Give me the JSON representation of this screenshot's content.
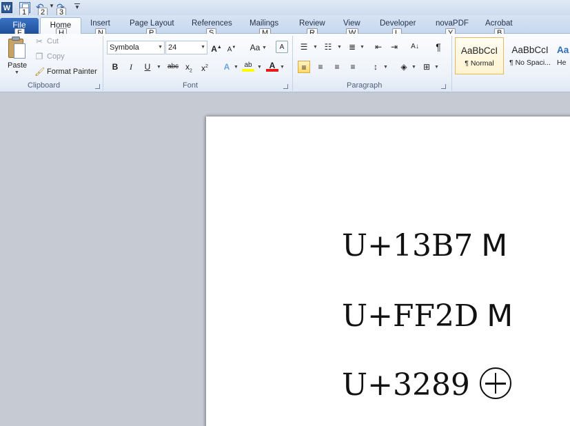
{
  "qat": {
    "app_icon_letter": "W",
    "keytips": [
      "1",
      "2",
      "3"
    ]
  },
  "tabs": [
    {
      "label": "File",
      "keytip": "F"
    },
    {
      "label": "Home",
      "keytip": "H"
    },
    {
      "label": "Insert",
      "keytip": "N"
    },
    {
      "label": "Page Layout",
      "keytip": "P"
    },
    {
      "label": "References",
      "keytip": "S"
    },
    {
      "label": "Mailings",
      "keytip": "M"
    },
    {
      "label": "Review",
      "keytip": "R"
    },
    {
      "label": "View",
      "keytip": "W"
    },
    {
      "label": "Developer",
      "keytip": "L"
    },
    {
      "label": "novaPDF",
      "keytip": "Y"
    },
    {
      "label": "Acrobat",
      "keytip": "B"
    }
  ],
  "clipboard": {
    "paste": "Paste",
    "cut": "Cut",
    "copy": "Copy",
    "format_painter": "Format Painter",
    "group_label": "Clipboard"
  },
  "font": {
    "name": "Symbola",
    "size": "24",
    "group_label": "Font",
    "change_case": "Aa"
  },
  "paragraph": {
    "group_label": "Paragraph"
  },
  "styles": [
    {
      "sample": "AaBbCcI",
      "name": "¶ Normal"
    },
    {
      "sample": "AaBbCcI",
      "name": "¶ No Spaci..."
    },
    {
      "sample": "Aa",
      "name": "He"
    }
  ],
  "document": {
    "lines": [
      {
        "code": "U+13B7",
        "glyph": "M"
      },
      {
        "code": "U+FF2D",
        "glyph": "M"
      },
      {
        "code": "U+3289",
        "glyph": ""
      }
    ]
  },
  "colors": {
    "file_tab": "#2b5fad",
    "highlight": "#ffff00",
    "font_color": "#e41b17",
    "selected_style_border": "#e8b85c"
  }
}
